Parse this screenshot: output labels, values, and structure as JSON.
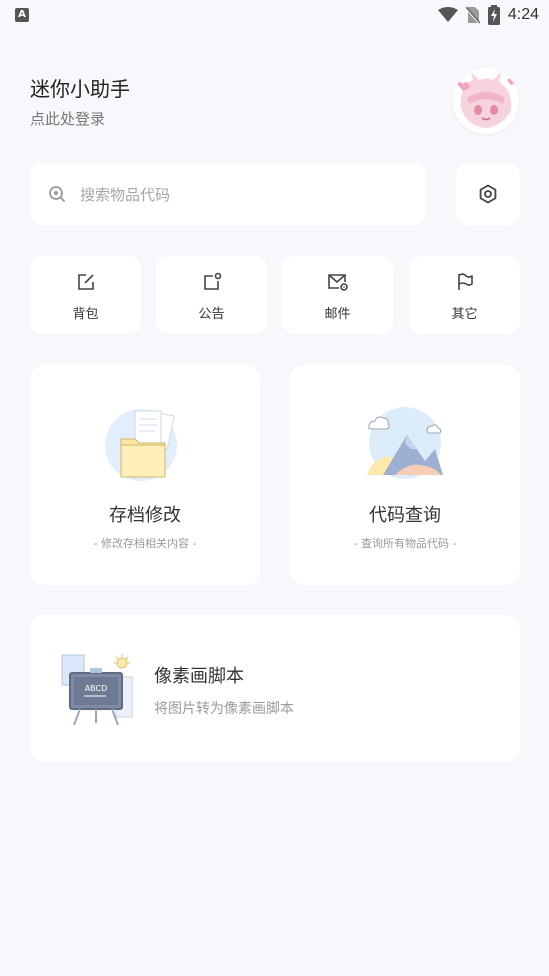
{
  "status_bar": {
    "app_badge": "A",
    "time": "4:24"
  },
  "header": {
    "title": "迷你小助手",
    "subtitle": "点此处登录"
  },
  "search": {
    "placeholder": "搜索物品代码"
  },
  "quick_actions": [
    {
      "label": "背包",
      "icon": "edit-square-icon"
    },
    {
      "label": "公告",
      "icon": "notice-icon"
    },
    {
      "label": "邮件",
      "icon": "mail-settings-icon"
    },
    {
      "label": "其它",
      "icon": "flag-icon"
    }
  ],
  "cards": [
    {
      "title": "存档修改",
      "subtitle": "- 修改存档相关内容 -",
      "icon": "folder-illustration"
    },
    {
      "title": "代码查询",
      "subtitle": "- 查询所有物品代码 -",
      "icon": "mountains-illustration"
    }
  ],
  "pixel_card": {
    "title": "像素画脚本",
    "subtitle": "将图片转为像素画脚本",
    "board_text": "ABCD",
    "icon": "chalkboard-illustration"
  },
  "colors": {
    "background": "#f7f7fc",
    "card": "#ffffff",
    "icon": "#555555"
  }
}
